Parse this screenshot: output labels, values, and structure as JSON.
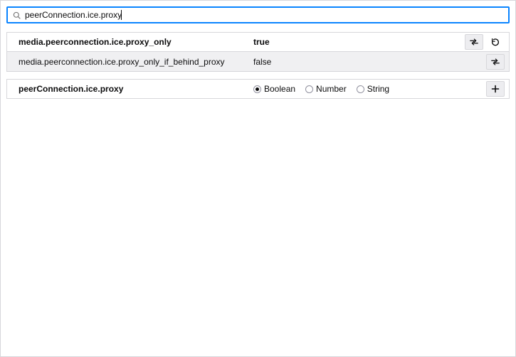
{
  "search": {
    "value": "peerConnection.ice.proxy"
  },
  "rows": [
    {
      "name": "media.peerconnection.ice.proxy_only",
      "value": "true",
      "modified": true,
      "hasReset": true
    },
    {
      "name": "media.peerconnection.ice.proxy_only_if_behind_proxy",
      "value": "false",
      "modified": false,
      "hasReset": false
    }
  ],
  "new_pref": {
    "name": "peerConnection.ice.proxy",
    "types": [
      "Boolean",
      "Number",
      "String"
    ],
    "selected": "Boolean"
  }
}
